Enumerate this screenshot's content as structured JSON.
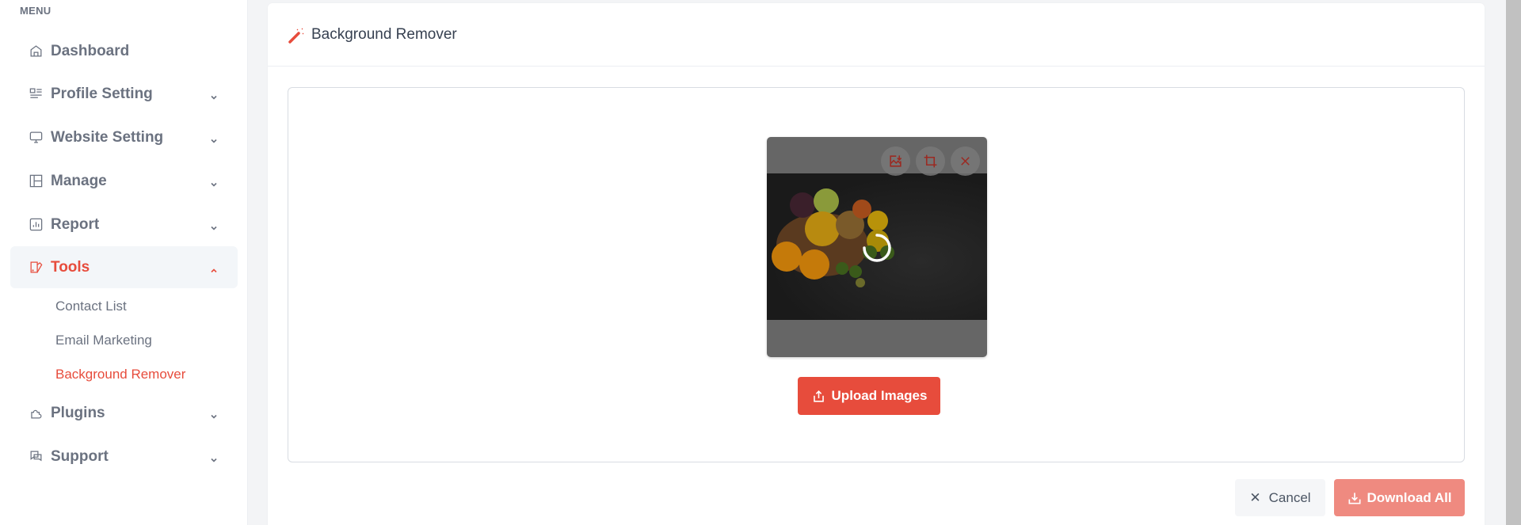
{
  "sidebar": {
    "menu_label": "MENU",
    "items": [
      {
        "label": "Dashboard",
        "icon": "home-icon",
        "has_chevron": false
      },
      {
        "label": "Profile Setting",
        "icon": "profile-list-icon",
        "has_chevron": true
      },
      {
        "label": "Website Setting",
        "icon": "monitor-icon",
        "has_chevron": true
      },
      {
        "label": "Manage",
        "icon": "layout-icon",
        "has_chevron": true
      },
      {
        "label": "Report",
        "icon": "chart-icon",
        "has_chevron": true
      },
      {
        "label": "Tools",
        "icon": "tools-icon",
        "has_chevron": true,
        "expanded": true,
        "active": true
      },
      {
        "label": "Plugins",
        "icon": "puzzle-icon",
        "has_chevron": true
      },
      {
        "label": "Support",
        "icon": "chat-icon",
        "has_chevron": true
      }
    ],
    "tools_subitems": [
      {
        "label": "Contact List"
      },
      {
        "label": "Email Marketing"
      },
      {
        "label": "Background Remover",
        "active": true
      }
    ]
  },
  "page": {
    "title": "Background Remover",
    "title_icon": "magic-wand-icon"
  },
  "preview": {
    "actions": [
      {
        "name": "save-image",
        "icon": "image-download-icon"
      },
      {
        "name": "crop",
        "icon": "crop-icon"
      },
      {
        "name": "remove",
        "icon": "close-icon"
      }
    ],
    "status": "loading"
  },
  "buttons": {
    "upload": "Upload Images",
    "cancel": "Cancel",
    "download_all": "Download All"
  },
  "colors": {
    "accent": "#e74c3c",
    "accent_disabled": "#ef8a80",
    "text_muted": "#6b7280"
  }
}
